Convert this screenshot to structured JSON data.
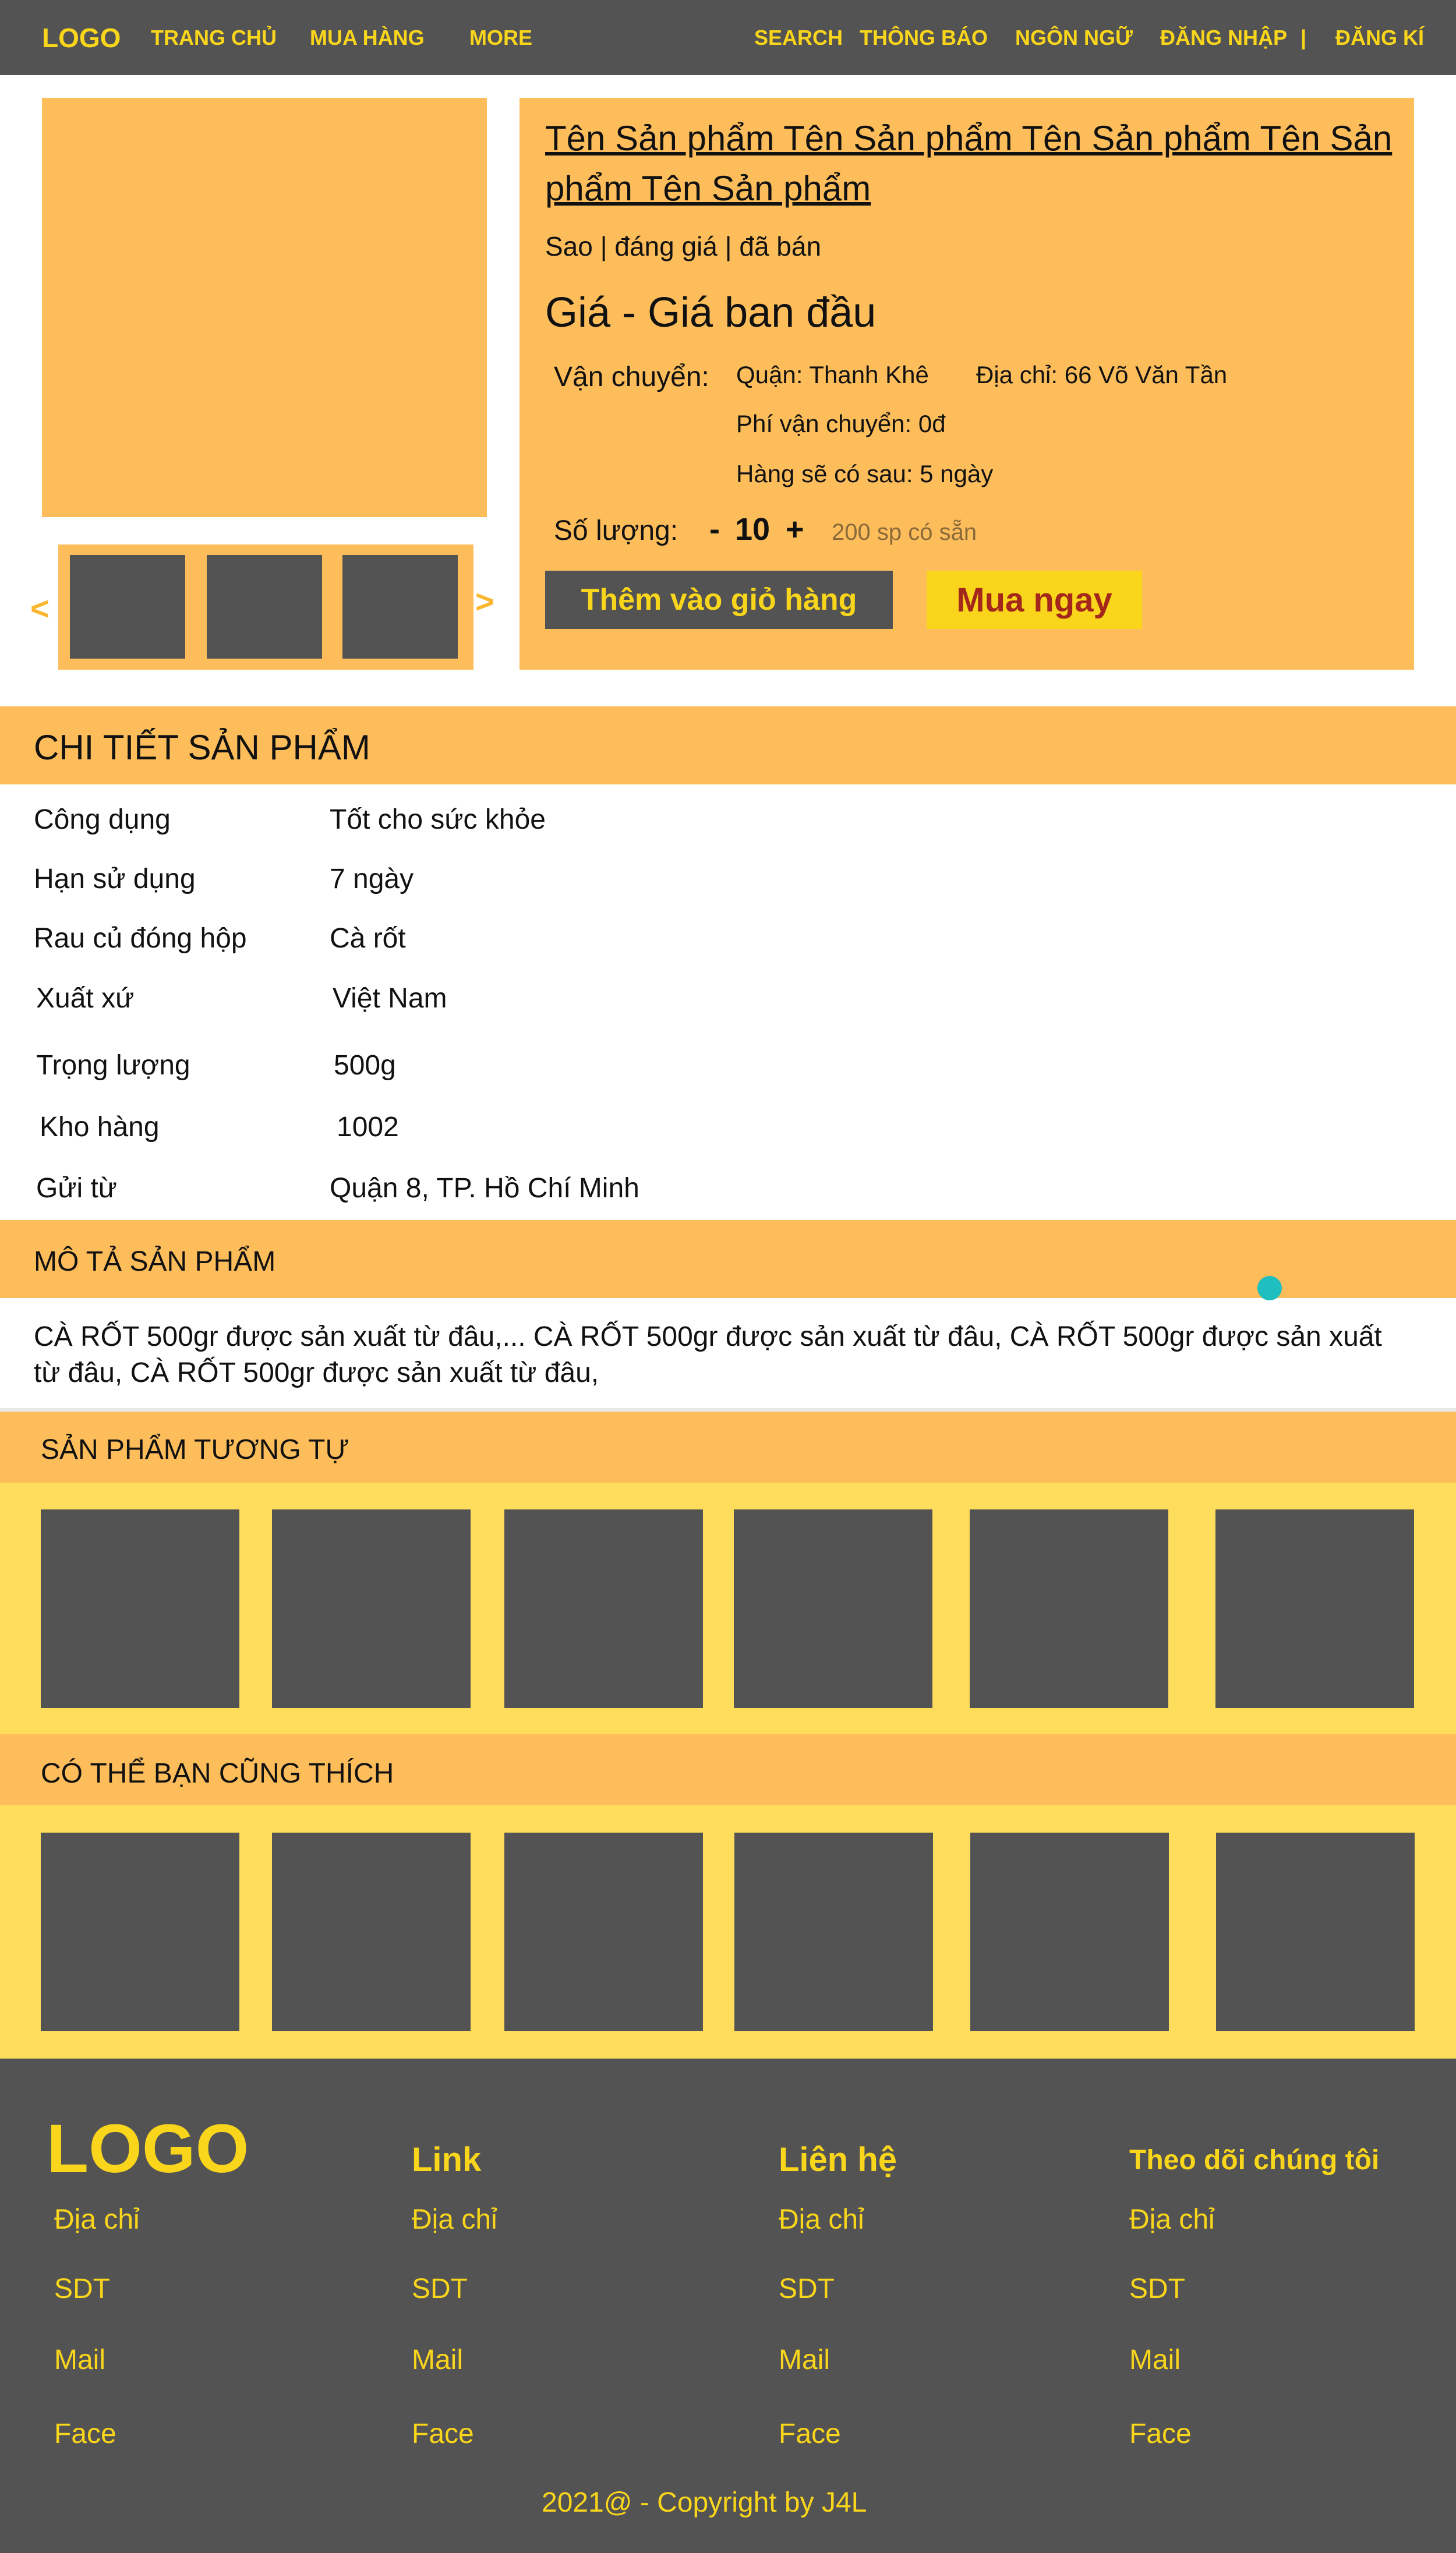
{
  "header": {
    "logo": "LOGO",
    "nav": [
      "TRANG CHỦ",
      "MUA HÀNG",
      "MORE"
    ],
    "right_nav": [
      "SEARCH",
      "THÔNG BÁO",
      "NGÔN NGỮ",
      "ĐĂNG NHẬP",
      "|",
      "ĐĂNG KÍ"
    ]
  },
  "gallery": {
    "prev_arrow": "<",
    "next_arrow": ">"
  },
  "product": {
    "title": "Tên Sản phẩm Tên Sản phẩm Tên Sản phẩm Tên Sản phẩm Tên Sản phẩm",
    "meta": "Sao | đáng giá | đã bán",
    "price": "Giá  - Giá ban đầu",
    "shipping_label": "Vận chuyển:",
    "district": "Quận: Thanh Khê",
    "address": "Địa chỉ: 66 Võ Văn Tần",
    "shipping_fee": "Phí vận chuyển:   0đ",
    "delivery": "Hàng sẽ có sau: 5 ngày",
    "quantity_label": "Số lượng:",
    "minus": "-",
    "quantity": "10",
    "plus": "+",
    "stock": "200 sp có sẵn",
    "add_to_cart": "Thêm vào giỏ hàng",
    "buy_now": "Mua ngay"
  },
  "details": {
    "heading": "CHI TIẾT SẢN PHẨM",
    "rows": [
      {
        "label": "Công dụng",
        "value": "Tốt cho sức khỏe"
      },
      {
        "label": "Hạn sử dụng",
        "value": "7 ngày"
      },
      {
        "label": "Rau củ đóng hộp",
        "value": "Cà rốt"
      },
      {
        "label": "Xuất xứ",
        "value": "Việt Nam"
      },
      {
        "label": "Trọng lượng",
        "value": "500g"
      },
      {
        "label": "Kho hàng",
        "value": "1002"
      },
      {
        "label": "Gửi từ",
        "value": "Quận 8, TP. Hồ Chí Minh"
      }
    ]
  },
  "description": {
    "heading": "MÔ TẢ SẢN PHẨM",
    "text": "CÀ RỐT 500gr được sản xuất từ đâu,... CÀ RỐT 500gr được sản xuất từ đâu, CÀ RỐT 500gr được sản xuất từ đâu, CÀ RỐT 500gr được sản xuất từ đâu,"
  },
  "similar": {
    "heading": "SẢN PHẨM TƯƠNG TỰ"
  },
  "suggested": {
    "heading": "CÓ THỂ BẠN CŨNG THÍCH"
  },
  "footer": {
    "logo": "LOGO",
    "columns": [
      {
        "heading": "Link",
        "links": [
          "Địa chỉ",
          "SDT",
          "Mail",
          "Face"
        ]
      },
      {
        "heading": "Liên hệ",
        "links": [
          "Địa chỉ",
          "SDT",
          "Mail",
          "Face"
        ]
      },
      {
        "heading": "Theo dõi chúng tôi",
        "links": [
          "Địa chỉ",
          "SDT",
          "Mail",
          "Face"
        ]
      }
    ],
    "logo_links": [
      "Địa chỉ",
      "SDT",
      "Mail",
      "Face"
    ],
    "copyright": "2021@  - Copyright by J4L"
  },
  "colors": {
    "dark": "#535353",
    "accent_yellow": "#f9d61b",
    "orange": "#fdbd5b",
    "light_yellow": "#fddd5b",
    "buy_text": "#a4271b",
    "cursor_dot": "#1fbfbf"
  }
}
